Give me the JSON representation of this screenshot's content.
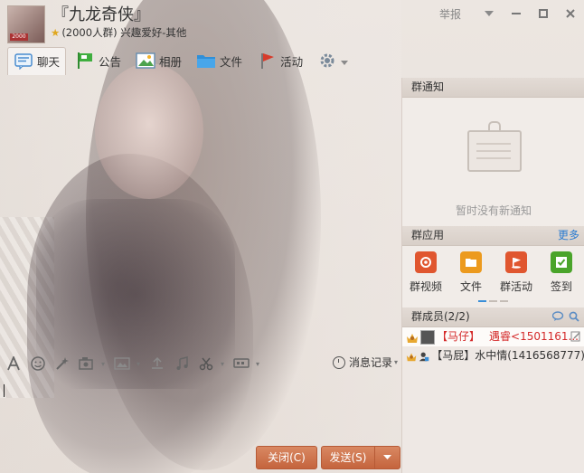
{
  "group": {
    "name": "『九龙奇侠』",
    "meta": "(2000人群) 兴趣爱好-其他",
    "avatar_badge": "2000"
  },
  "window": {
    "report_label": "举报"
  },
  "toolbar": {
    "items": [
      {
        "label": "聊天",
        "icon": "chat-bubble-icon"
      },
      {
        "label": "公告",
        "icon": "flag-icon"
      },
      {
        "label": "相册",
        "icon": "photo-icon"
      },
      {
        "label": "文件",
        "icon": "folder-icon"
      },
      {
        "label": "活动",
        "icon": "event-flag-icon"
      }
    ],
    "settings_icon": "gear-icon"
  },
  "notice": {
    "title": "群通知",
    "empty_text": "暂时没有新通知"
  },
  "apps": {
    "title": "群应用",
    "more_label": "更多",
    "items": [
      {
        "label": "群视频",
        "icon": "video-icon",
        "color": "#e0562f"
      },
      {
        "label": "文件",
        "icon": "file-icon",
        "color": "#ec9a1e"
      },
      {
        "label": "群活动",
        "icon": "activity-icon",
        "color": "#e0562f"
      },
      {
        "label": "签到",
        "icon": "checkin-icon",
        "color": "#4aa42a"
      }
    ]
  },
  "members": {
    "title": "群成员(2/2)",
    "list": [
      {
        "tag": "【马仔】",
        "name": "",
        "note": "遇睿<1501161..."
      },
      {
        "tag": "【马屁】",
        "name": "水中情(1416568777)",
        "note": ""
      }
    ]
  },
  "input_toolbar": {
    "history_label": "消息记录"
  },
  "buttons": {
    "close_label": "关闭(C)",
    "send_label": "发送(S)"
  },
  "colors": {
    "accent_button": "#c96a42",
    "link_blue": "#2a7bd0",
    "member_tag_red": "#d42a2a"
  }
}
